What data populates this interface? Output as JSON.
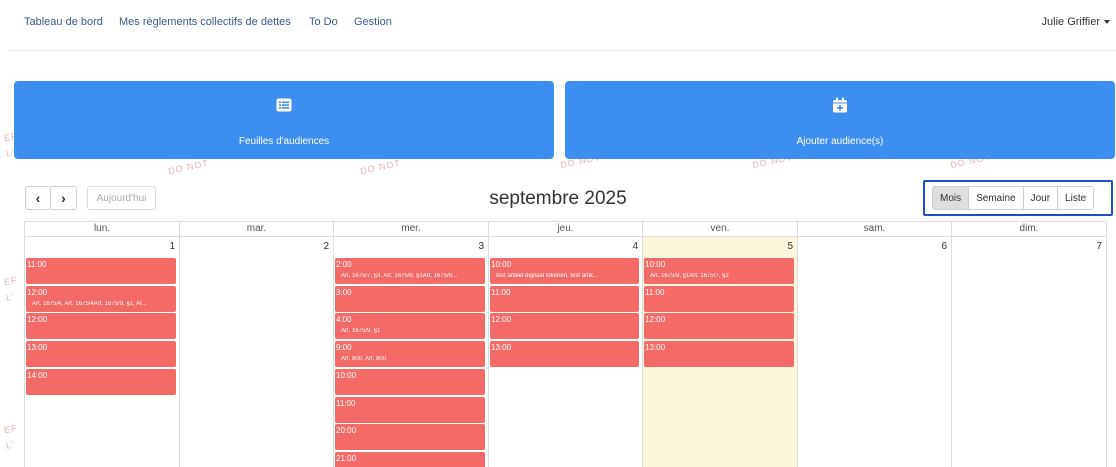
{
  "nav": {
    "items": [
      "Tableau de bord",
      "Mes règlements collectifs de dettes",
      "To Do",
      "Gestion"
    ],
    "user": "Julie Griffier"
  },
  "watermark": {
    "text": "DO NOT",
    "fragments": [
      "EF",
      "L'"
    ]
  },
  "actions": {
    "sessions_label": "Feuilles d'audiences",
    "add_label": "Ajouter audience(s)",
    "sessions_icon": "list-icon",
    "add_icon": "calendar-plus-icon"
  },
  "toolbar": {
    "prev": "‹",
    "next": "›",
    "today": "Aujourd'hui",
    "title": "septembre 2025",
    "views": [
      "Mois",
      "Semaine",
      "Jour",
      "Liste"
    ],
    "active_view": "Mois"
  },
  "calendar": {
    "day_names": [
      "lun.",
      "mar.",
      "mer.",
      "jeu.",
      "ven.",
      "sam.",
      "dim."
    ],
    "day_numbers": [
      "1",
      "2",
      "3",
      "4",
      "5",
      "6",
      "7"
    ],
    "today_index": 4,
    "event_color": "#f26b66",
    "days": [
      {
        "events": [
          {
            "time": "11:00",
            "title": ""
          },
          {
            "time": "12:00",
            "title": "Art. 1675/4, Art. 1675/4Art. 1675/9, §1, Ar..."
          },
          {
            "time": "12:00",
            "title": ""
          },
          {
            "time": "13:00",
            "title": ""
          },
          {
            "time": "14:00",
            "title": ""
          }
        ]
      },
      {
        "events": []
      },
      {
        "events": [
          {
            "time": "2:00",
            "title": "Art. 1675/7, §3, Art. 1675/9, §1Art. 1675/8..."
          },
          {
            "time": "3:00",
            "title": ""
          },
          {
            "time": "4:00",
            "title": "Art. 1675/9, §1"
          },
          {
            "time": "9:00",
            "title": "Art. 800, Art. 800"
          },
          {
            "time": "10:00",
            "title": ""
          },
          {
            "time": "11:00",
            "title": ""
          },
          {
            "time": "20:00",
            "title": ""
          },
          {
            "time": "21:00",
            "title": ""
          }
        ]
      },
      {
        "events": [
          {
            "time": "10:00",
            "title": "test artikel digitaal tokenen, test artik..."
          },
          {
            "time": "11:00",
            "title": ""
          },
          {
            "time": "12:00",
            "title": ""
          },
          {
            "time": "13:00",
            "title": ""
          }
        ]
      },
      {
        "events": [
          {
            "time": "10:00",
            "title": "Art. 1675/9, §1Art. 1675/7, §2"
          },
          {
            "time": "11:00",
            "title": ""
          },
          {
            "time": "12:00",
            "title": ""
          },
          {
            "time": "13:00",
            "title": ""
          }
        ]
      },
      {
        "events": []
      },
      {
        "events": []
      }
    ]
  }
}
